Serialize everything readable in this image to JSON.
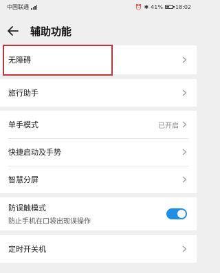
{
  "status_bar": {
    "carrier": "中国联通",
    "battery_percent": "41%",
    "time": "18:02"
  },
  "header": {
    "title": "辅助功能"
  },
  "sections": {
    "accessibility": {
      "label": "无障碍"
    },
    "travel_assistant": {
      "label": "旅行助手"
    },
    "one_hand_mode": {
      "label": "单手模式",
      "value": "已开启"
    },
    "shortcut_gestures": {
      "label": "快捷启动及手势"
    },
    "smart_split": {
      "label": "智慧分屏"
    },
    "mistouch": {
      "label": "防误触模式",
      "description": "防止手机在口袋出现误操作",
      "enabled": true
    },
    "scheduled_power": {
      "label": "定时开关机"
    }
  },
  "colors": {
    "toggle_on": "#1e8ee6",
    "highlight_border": "#c0353a"
  }
}
